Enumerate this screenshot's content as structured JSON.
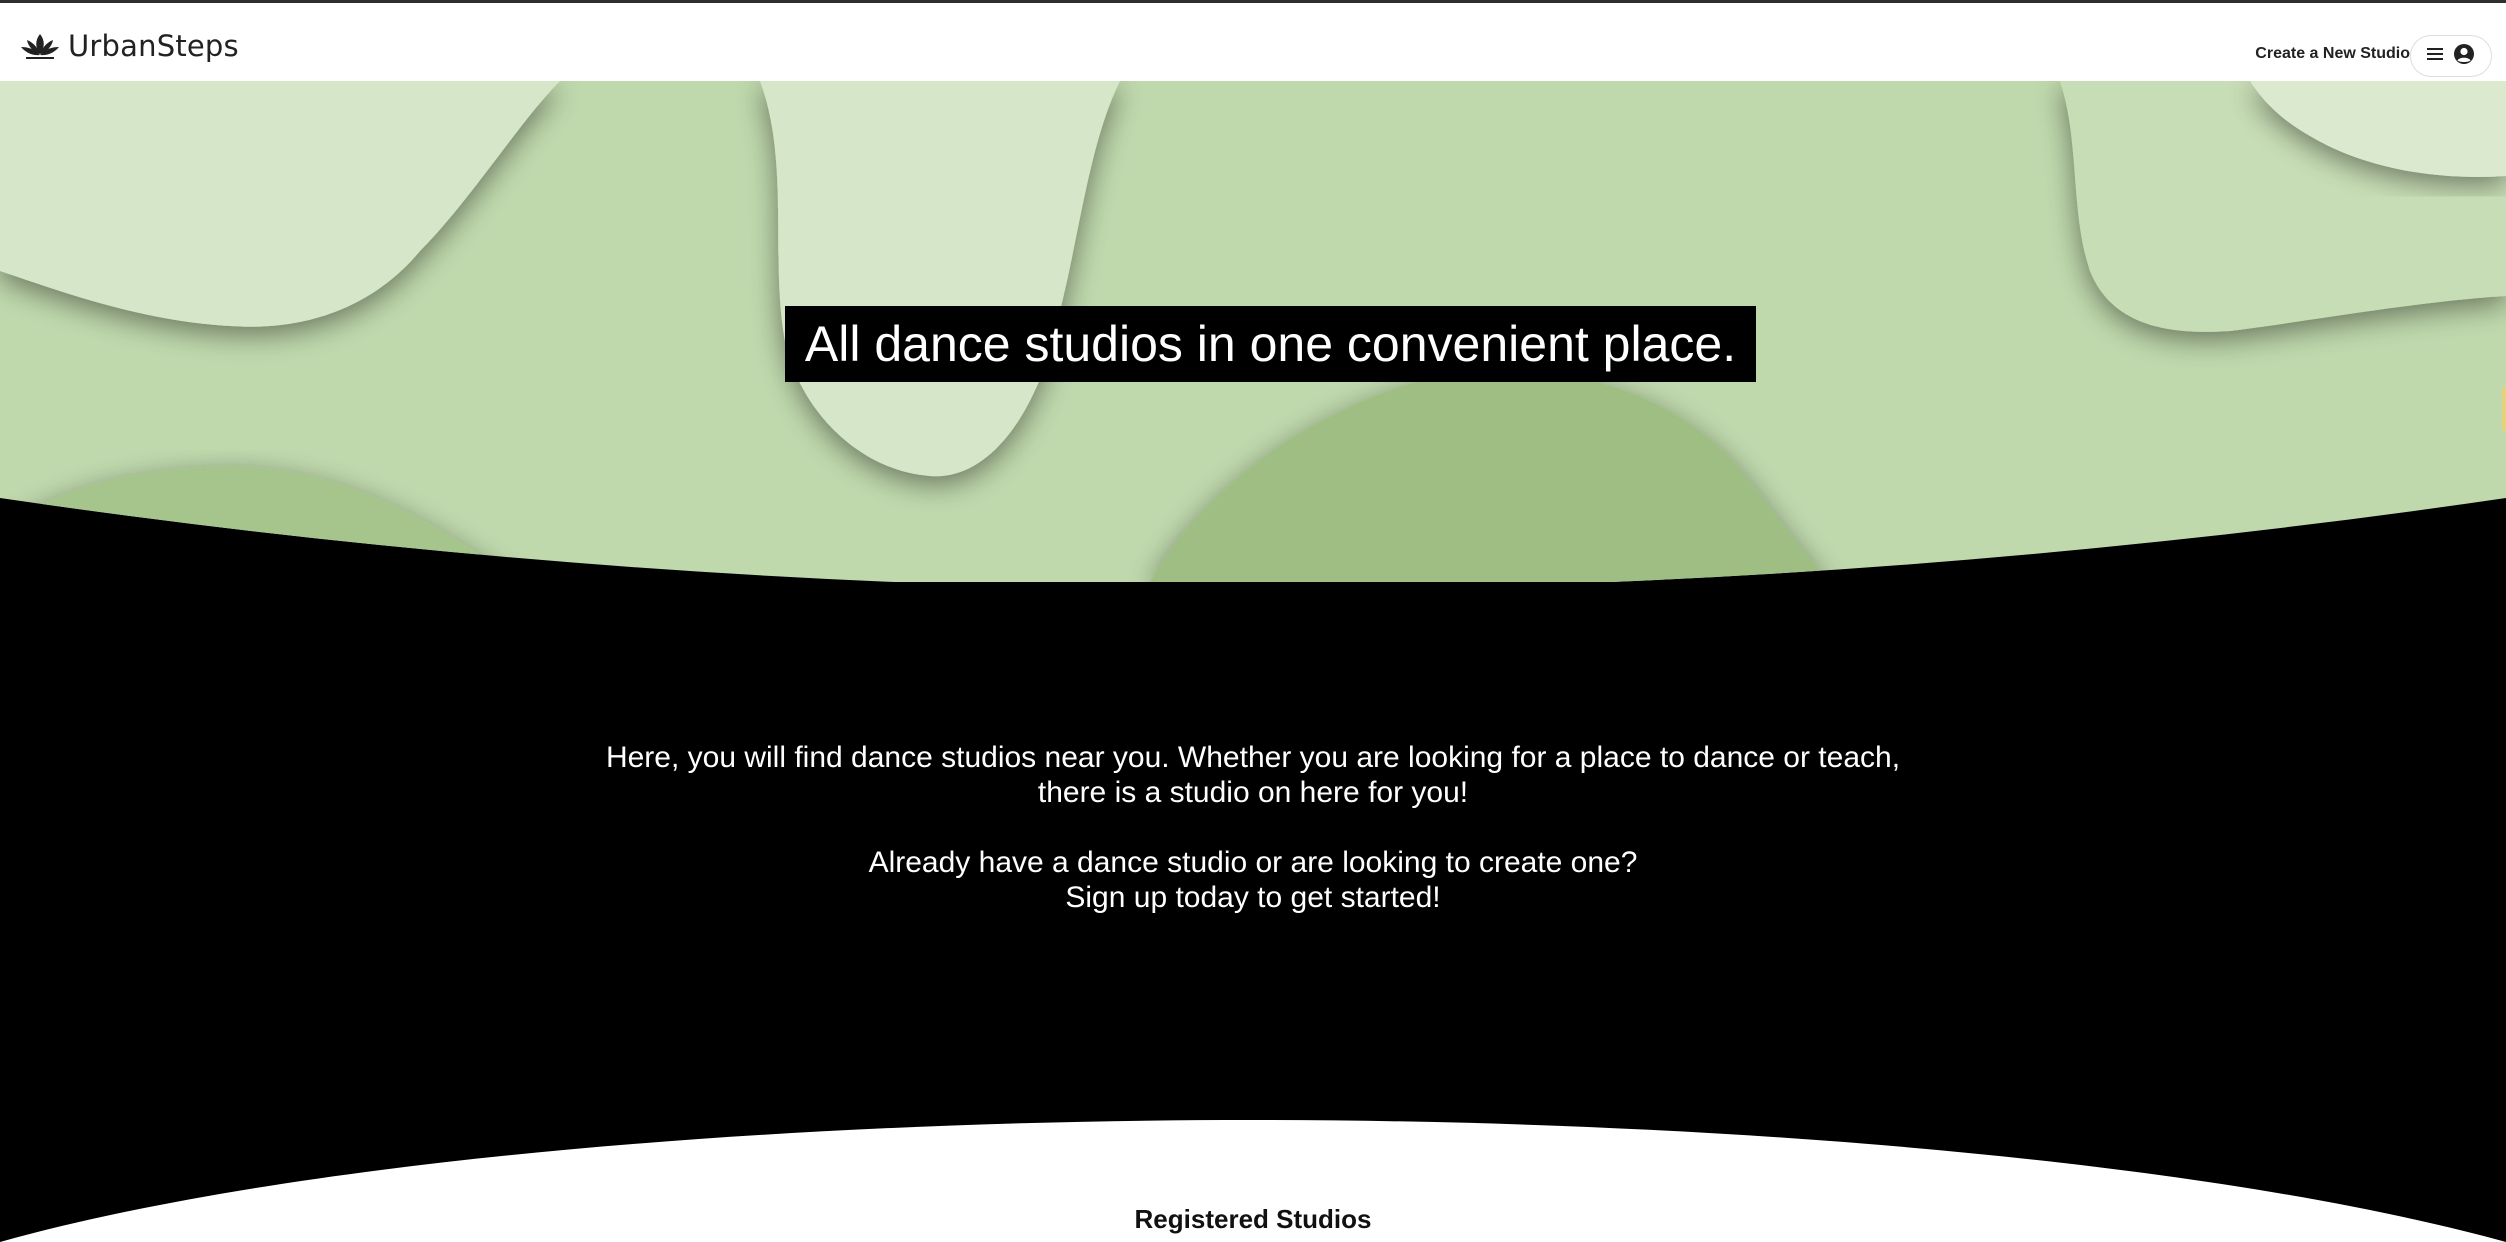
{
  "navbar": {
    "brand_name": "UrbanSteps",
    "logo_icon": "lotus-icon",
    "create_studio_label": "Create a New Studio",
    "menu_icon": "hamburger-icon",
    "account_icon": "user-circle-icon"
  },
  "hero": {
    "title": "All dance studios in one convenient place."
  },
  "intro": {
    "line1": "Here, you will find dance studios near you. Whether you are looking for a place to dance or teach,",
    "line2": "there is a studio on here for you!",
    "line3": "Already have a dance studio or are looking to create one?",
    "line4": "Sign up today to get started!"
  },
  "studios_section": {
    "heading": "Registered Studios"
  },
  "colors": {
    "hero_light": "#d6e6c8",
    "hero_mid": "#bfd8ac",
    "hero_dark": "#9ebe84",
    "background": "#000000",
    "navbar": "#ffffff"
  }
}
